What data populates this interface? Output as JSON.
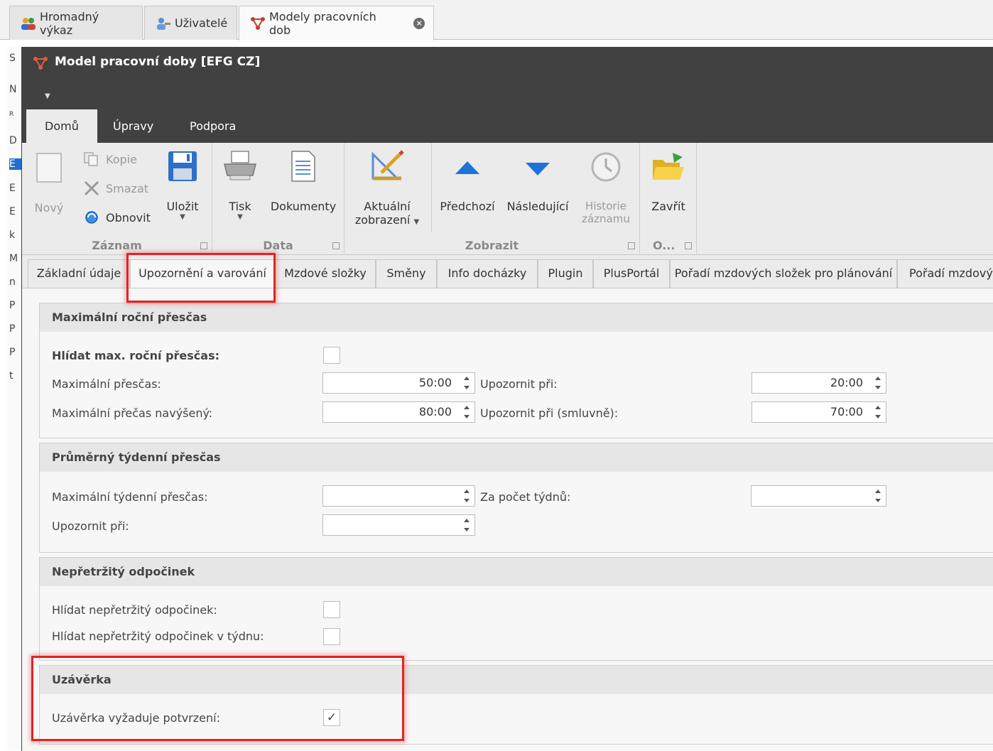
{
  "doc_tabs": [
    {
      "label": "Hromadný výkaz"
    },
    {
      "label": "Uživatelé"
    },
    {
      "label": "Modely pracovních dob"
    }
  ],
  "bg_list": [
    "S",
    "N",
    "R",
    "D",
    "E",
    "E",
    "E",
    "k",
    "M",
    "n",
    "P",
    "P",
    "P",
    "t"
  ],
  "window": {
    "title": "Model pracovní doby [EFG CZ]",
    "menu_tabs": [
      "Domů",
      "Úpravy",
      "Podpora"
    ]
  },
  "ribbon": {
    "zaznam": {
      "label": "Záznam",
      "novy": "Nový",
      "kopie": "Kopie",
      "smazat": "Smazat",
      "obnovit": "Obnovit",
      "ulozit": "Uložit"
    },
    "data": {
      "label": "Data",
      "tisk": "Tisk",
      "dokumenty": "Dokumenty"
    },
    "zobrazit": {
      "label": "Zobrazit",
      "aktualni_line1": "Aktuální",
      "aktualni_line2": "zobrazení",
      "predchozi": "Předchozí",
      "nasledujici": "Následující",
      "historie_line1": "Historie",
      "historie_line2": "záznamu"
    },
    "other": {
      "label": "O...",
      "zavrit": "Zavřít"
    }
  },
  "page_tabs": [
    "Základní údaje",
    "Upozornění a varování",
    "Mzdové složky",
    "Směny",
    "Info docházky",
    "Plugin",
    "PlusPortál",
    "Pořadí mzdových složek pro plánování",
    "Pořadí mzdový"
  ],
  "groups": {
    "rocni": {
      "title": "Maximální roční přesčas",
      "hlidat_label": "Hlídat max. roční přesčas:",
      "hlidat_checked": false,
      "max_label": "Maximální přesčas:",
      "max_value": "50:00",
      "upozornit_label": "Upozornit při:",
      "upozornit_value": "20:00",
      "navyseny_label": "Maximální přečas navýšený:",
      "navyseny_value": "80:00",
      "smluvne_label": "Upozornit při (smluvně):",
      "smluvne_value": "70:00"
    },
    "tydenni": {
      "title": "Průměrný týdenní přesčas",
      "max_label": "Maximální týdenní přesčas:",
      "max_value": "",
      "pocet_label": "Za počet týdnů:",
      "pocet_value": "",
      "upozornit_label": "Upozornit při:",
      "upozornit_value": ""
    },
    "odpocinek": {
      "title": "Nepřetržitý odpočinek",
      "hlidat_label": "Hlídat nepřetržitý odpočinek:",
      "hlidat_checked": false,
      "tyden_label": "Hlídat nepřetržitý odpočinek v týdnu:",
      "tyden_checked": false
    },
    "uzaverka": {
      "title": "Uzávěrka",
      "potvrzeni_label": "Uzávěrka vyžaduje potvrzení:",
      "potvrzeni_checked": true,
      "check_mark": "✓"
    }
  },
  "colors": {
    "titlebar": "#414141",
    "highlight": "#e02424",
    "arrow_blue": "#1e73d8"
  }
}
